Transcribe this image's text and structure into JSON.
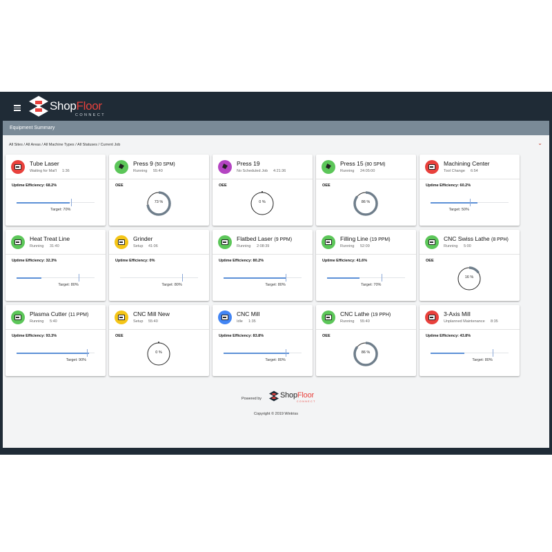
{
  "app": {
    "brand_main": "Shop",
    "brand_accent": "Floor",
    "brand_sub": "CONNECT",
    "header_bg": "#1f2b36",
    "accent": "#e8413c"
  },
  "page": {
    "title": "Equipment Summary",
    "breadcrumb": "All Sites / All Areas / All Machine Types / All Statuses / Current Job"
  },
  "status_colors": {
    "red": "#e8413c",
    "green": "#5cc659",
    "purple": "#b444c2",
    "yellow": "#f4c518",
    "blue": "#4285f4"
  },
  "machines": [
    {
      "name": "Tube Laser",
      "rate": "",
      "icon": "laser-icon",
      "color": "#e8413c",
      "status": "Waiting for Mat'l",
      "time": "1:36",
      "metric": "bar",
      "label": "Uptime Efficiency: 68.2%",
      "value": 68.2,
      "target": 70,
      "target_label": "Target: 70%"
    },
    {
      "name": "Press 9",
      "rate": "(50 SPM)",
      "icon": "press-icon",
      "color": "#5cc659",
      "status": "Running",
      "time": "55:40",
      "metric": "gauge",
      "label": "OEE",
      "value": 73,
      "value_label": "73 %"
    },
    {
      "name": "Press 19",
      "rate": "",
      "icon": "press-icon",
      "color": "#b444c2",
      "status": "No Scheduled Job",
      "time": "4:21:36",
      "metric": "gauge",
      "label": "OEE",
      "value": 0,
      "value_label": "0 %"
    },
    {
      "name": "Press 15",
      "rate": "(80 SPM)",
      "icon": "press-icon",
      "color": "#5cc659",
      "status": "Running",
      "time": "24:05:00",
      "metric": "gauge",
      "label": "OEE",
      "value": 86,
      "value_label": "86 %"
    },
    {
      "name": "Machining Center",
      "rate": "",
      "icon": "machining-center-icon",
      "color": "#e8413c",
      "status": "Tool Change",
      "time": "6:54",
      "metric": "bar",
      "label": "Uptime Efficiency:  60.2%",
      "value": 60.2,
      "target": 50,
      "target_label": "Target: 50%"
    },
    {
      "name": "Heat Treat Line",
      "rate": "",
      "icon": "heat-treat-icon",
      "color": "#5cc659",
      "status": "Running",
      "time": "31:40",
      "metric": "bar",
      "label": "Uptime Efficiency: 32.3%",
      "value": 32.3,
      "target": 80,
      "target_label": "Target: 80%"
    },
    {
      "name": "Grinder",
      "rate": "",
      "icon": "grinder-icon",
      "color": "#f4c518",
      "status": "Setup",
      "time": "41:06",
      "metric": "bar",
      "label": "Uptime Efficiency: 0%",
      "value": 0,
      "target": 80,
      "target_label": "Target: 80%"
    },
    {
      "name": "Flatbed Laser",
      "rate": "(9 PPM)",
      "icon": "laser-icon",
      "color": "#5cc659",
      "status": "Running",
      "time": "2:08:39",
      "metric": "bar",
      "label": "Uptime Efficiency: 80.2%",
      "value": 80.2,
      "target": 80,
      "target_label": "Target: 80%"
    },
    {
      "name": "Filling Line",
      "rate": "(19 PPM)",
      "icon": "filling-line-icon",
      "color": "#5cc659",
      "status": "Running",
      "time": "52:09",
      "metric": "bar",
      "label": "Uptime Efficiency: 41.6%",
      "value": 41.6,
      "target": 70,
      "target_label": "Target: 70%"
    },
    {
      "name": "CNC Swiss Lathe",
      "rate": "(8 PPH)",
      "icon": "lathe-icon",
      "color": "#5cc659",
      "status": "Running",
      "time": "5:00",
      "metric": "gauge",
      "label": "OEE",
      "value": 16,
      "value_label": "16 %"
    },
    {
      "name": "Plasma Cutter",
      "rate": "(11 PPM)",
      "icon": "plasma-cutter-icon",
      "color": "#5cc659",
      "status": "Running",
      "time": "5:40",
      "metric": "bar",
      "label": "Uptime Efficiency:        93.3%",
      "value": 93.3,
      "target": 90,
      "target_label": "Target: 90%"
    },
    {
      "name": "CNC Mill New",
      "rate": "",
      "icon": "mill-icon",
      "color": "#f4c518",
      "status": "Setup",
      "time": "55:40",
      "metric": "gauge",
      "label": "OEE",
      "value": 0,
      "value_label": "0 %"
    },
    {
      "name": "CNC Mill",
      "rate": "",
      "icon": "mill-icon",
      "color": "#4285f4",
      "status": "Idle",
      "time": "1:35",
      "metric": "bar",
      "label": "Uptime Efficiency: 83.8%",
      "value": 83.8,
      "target": 80,
      "target_label": "Target: 80%"
    },
    {
      "name": "CNC Lathe",
      "rate": "(19 PPH)",
      "icon": "lathe-icon",
      "color": "#5cc659",
      "status": "Running",
      "time": "55:40",
      "metric": "gauge",
      "label": "OEE",
      "value": 86,
      "value_label": "86 %"
    },
    {
      "name": "3-Axis Mill",
      "rate": "",
      "icon": "mill-icon",
      "color": "#e8413c",
      "status": "Unplanned Maintenance",
      "time": "8:35",
      "metric": "bar",
      "label": "Uptime Efficiency: 43.8%",
      "value": 43.8,
      "target": 80,
      "target_label": "Target: 80%"
    }
  ],
  "footer": {
    "powered_by": "Powered by",
    "brand_main": "Shop",
    "brand_accent": "Floor",
    "brand_sub": "CONNECT",
    "copyright": "Copyright © 2019 Wintriss"
  }
}
